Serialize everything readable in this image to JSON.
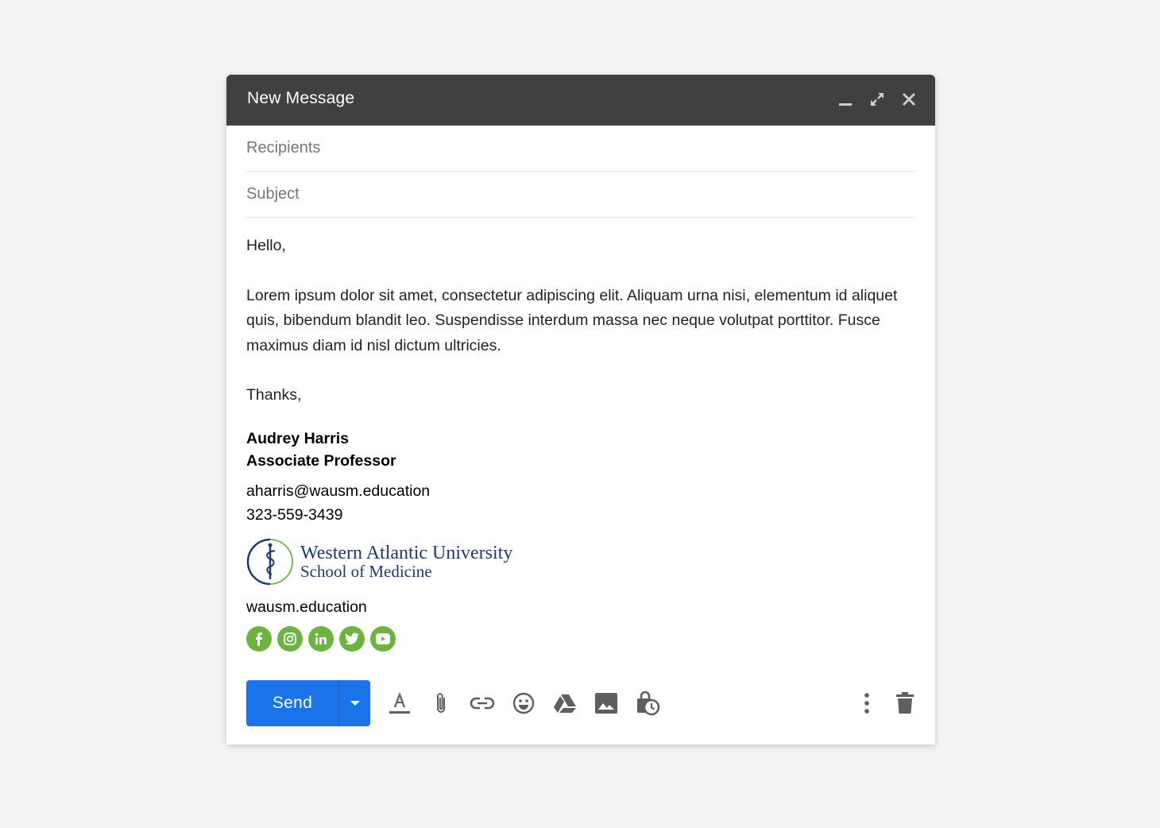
{
  "window": {
    "title": "New Message",
    "controls": [
      "minimize",
      "expand",
      "close"
    ]
  },
  "fields": {
    "recipients_placeholder": "Recipients",
    "recipients_value": "",
    "subject_placeholder": "Subject",
    "subject_value": ""
  },
  "body": {
    "greeting": "Hello,",
    "paragraph": "Lorem ipsum dolor sit amet, consectetur adipiscing elit. Aliquam urna nisi, elementum id aliquet quis, bibendum blandit leo. Suspendisse interdum massa nec neque volutpat porttitor. Fusce maximus diam id nisl dictum ultricies.",
    "closing": "Thanks,"
  },
  "signature": {
    "name": "Audrey Harris",
    "title": "Associate Professor",
    "email": "aharris@wausm.education",
    "phone": "323-559-3439",
    "logo_line1": "Western Atlantic University",
    "logo_line2": "School of Medicine",
    "website": "wausm.education",
    "social_color": "#6db33f",
    "social": [
      "facebook",
      "instagram",
      "linkedin",
      "twitter",
      "youtube"
    ]
  },
  "toolbar": {
    "send_label": "Send",
    "send_color": "#1a73e8",
    "tools": [
      "formatting-options",
      "attach-files",
      "insert-link",
      "insert-emoji",
      "insert-from-drive",
      "insert-photo",
      "confidential-mode"
    ],
    "more_options": "more-options",
    "discard": "discard-draft"
  }
}
